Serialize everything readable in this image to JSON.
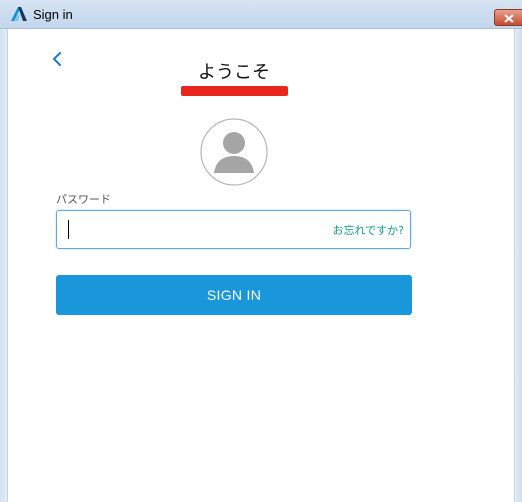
{
  "window": {
    "title": "Sign in",
    "logo_icon": "autodesk-logo-icon",
    "close_icon": "close-icon"
  },
  "header": {
    "back_icon": "chevron-left-icon",
    "welcome": "ようこそ"
  },
  "avatar": {
    "icon": "user-avatar-icon"
  },
  "password": {
    "label": "パスワード",
    "value": "",
    "placeholder": "",
    "forgot_link": "お忘れですか?"
  },
  "actions": {
    "sign_in": "SIGN IN"
  },
  "colors": {
    "accent": "#1a96db",
    "link": "#159a8c",
    "back_chevron": "#1a7bc7",
    "redaction": "#e8261b"
  }
}
